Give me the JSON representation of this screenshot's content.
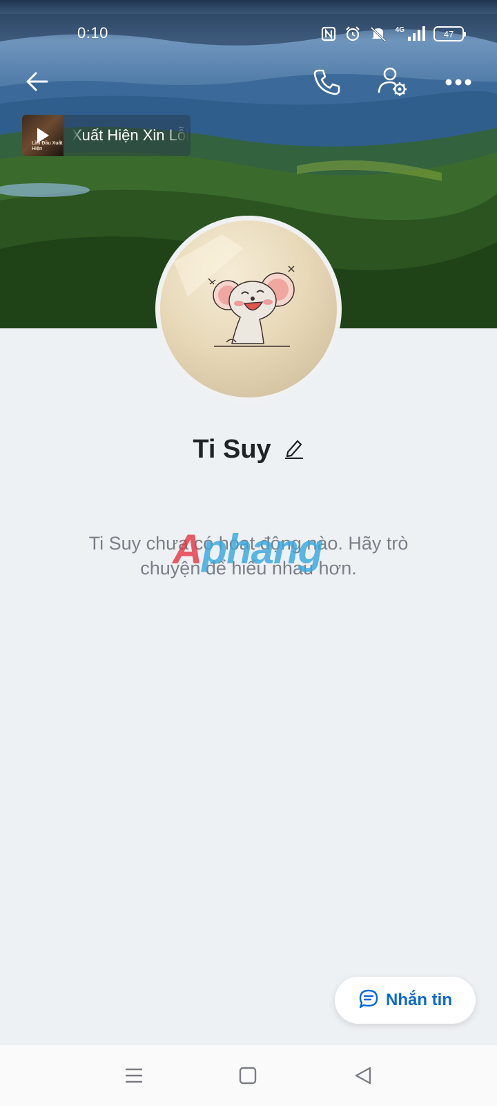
{
  "status_bar": {
    "time": "0:10",
    "network_label": "4G",
    "battery_level": "47",
    "icons": [
      "nfc-icon",
      "alarm-icon",
      "mute-icon",
      "signal-icon",
      "battery-icon"
    ]
  },
  "header": {
    "icons": [
      "back-arrow-icon",
      "phone-call-icon",
      "user-settings-icon",
      "more-icon"
    ]
  },
  "music": {
    "title": "Xuất Hiện     Xin Lỗi",
    "thumbnail_text": "Lần Đầu Xuất Hiện"
  },
  "profile": {
    "name": "Ti Suy",
    "edit_icon": "pencil-icon"
  },
  "feed": {
    "empty_message": "Ti Suy chưa có hoạt động nào. Hãy trò chuyện để hiểu nhau hơn."
  },
  "watermark": {
    "part1": "A",
    "part2": "phang"
  },
  "actions": {
    "message_label": "Nhắn tin",
    "message_icon": "chat-bubble-icon"
  },
  "nav_bar": {
    "icons": [
      "menu-icon",
      "home-square-icon",
      "back-triangle-icon"
    ]
  },
  "colors": {
    "accent": "#0a68d8",
    "background": "#eef1f4",
    "text_primary": "#1f2226",
    "text_secondary": "#7b8088"
  }
}
